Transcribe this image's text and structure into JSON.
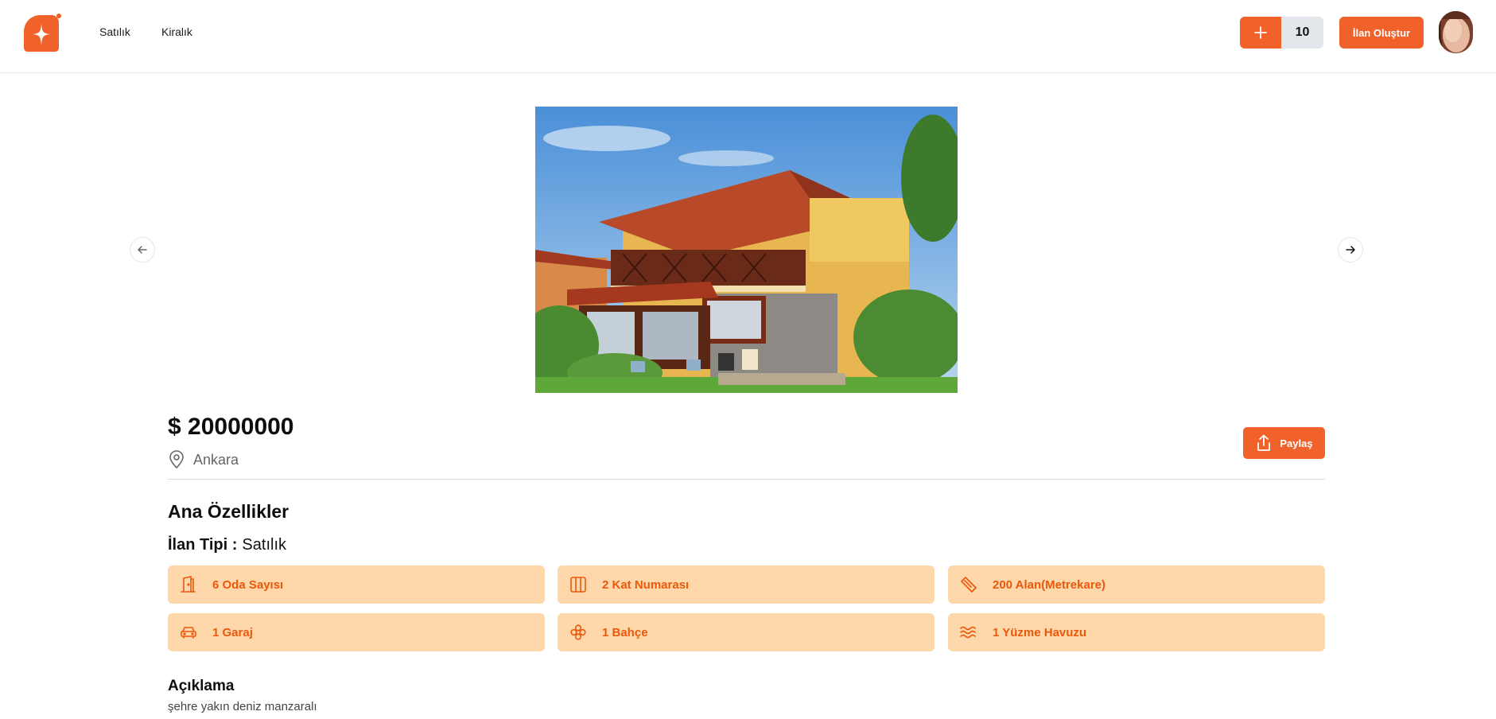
{
  "header": {
    "nav": {
      "sale": "Satılık",
      "rent": "Kiralık"
    },
    "counter": {
      "plus": "+",
      "count": "10"
    },
    "create_button": "İlan Oluştur"
  },
  "listing": {
    "price": "$ 20000000",
    "location": "Ankara",
    "share_button": "Paylaş",
    "section_title": "Ana Özellikler",
    "type_label": "İlan Tipi :",
    "type_value": "Satılık",
    "features": [
      {
        "label": "6 Oda Sayısı",
        "icon": "door-icon"
      },
      {
        "label": "2 Kat Numarası",
        "icon": "columns-icon"
      },
      {
        "label": "200 Alan(Metrekare)",
        "icon": "ruler-icon"
      },
      {
        "label": "1 Garaj",
        "icon": "car-icon"
      },
      {
        "label": "1 Bahçe",
        "icon": "flower-icon"
      },
      {
        "label": "1 Yüzme Havuzu",
        "icon": "waves-icon"
      }
    ],
    "description_title": "Açıklama",
    "description": "şehre yakın deniz manzaralı"
  },
  "colors": {
    "accent": "#f1612a",
    "feature_bg": "#fed7aa",
    "feature_text": "#ea580c"
  }
}
